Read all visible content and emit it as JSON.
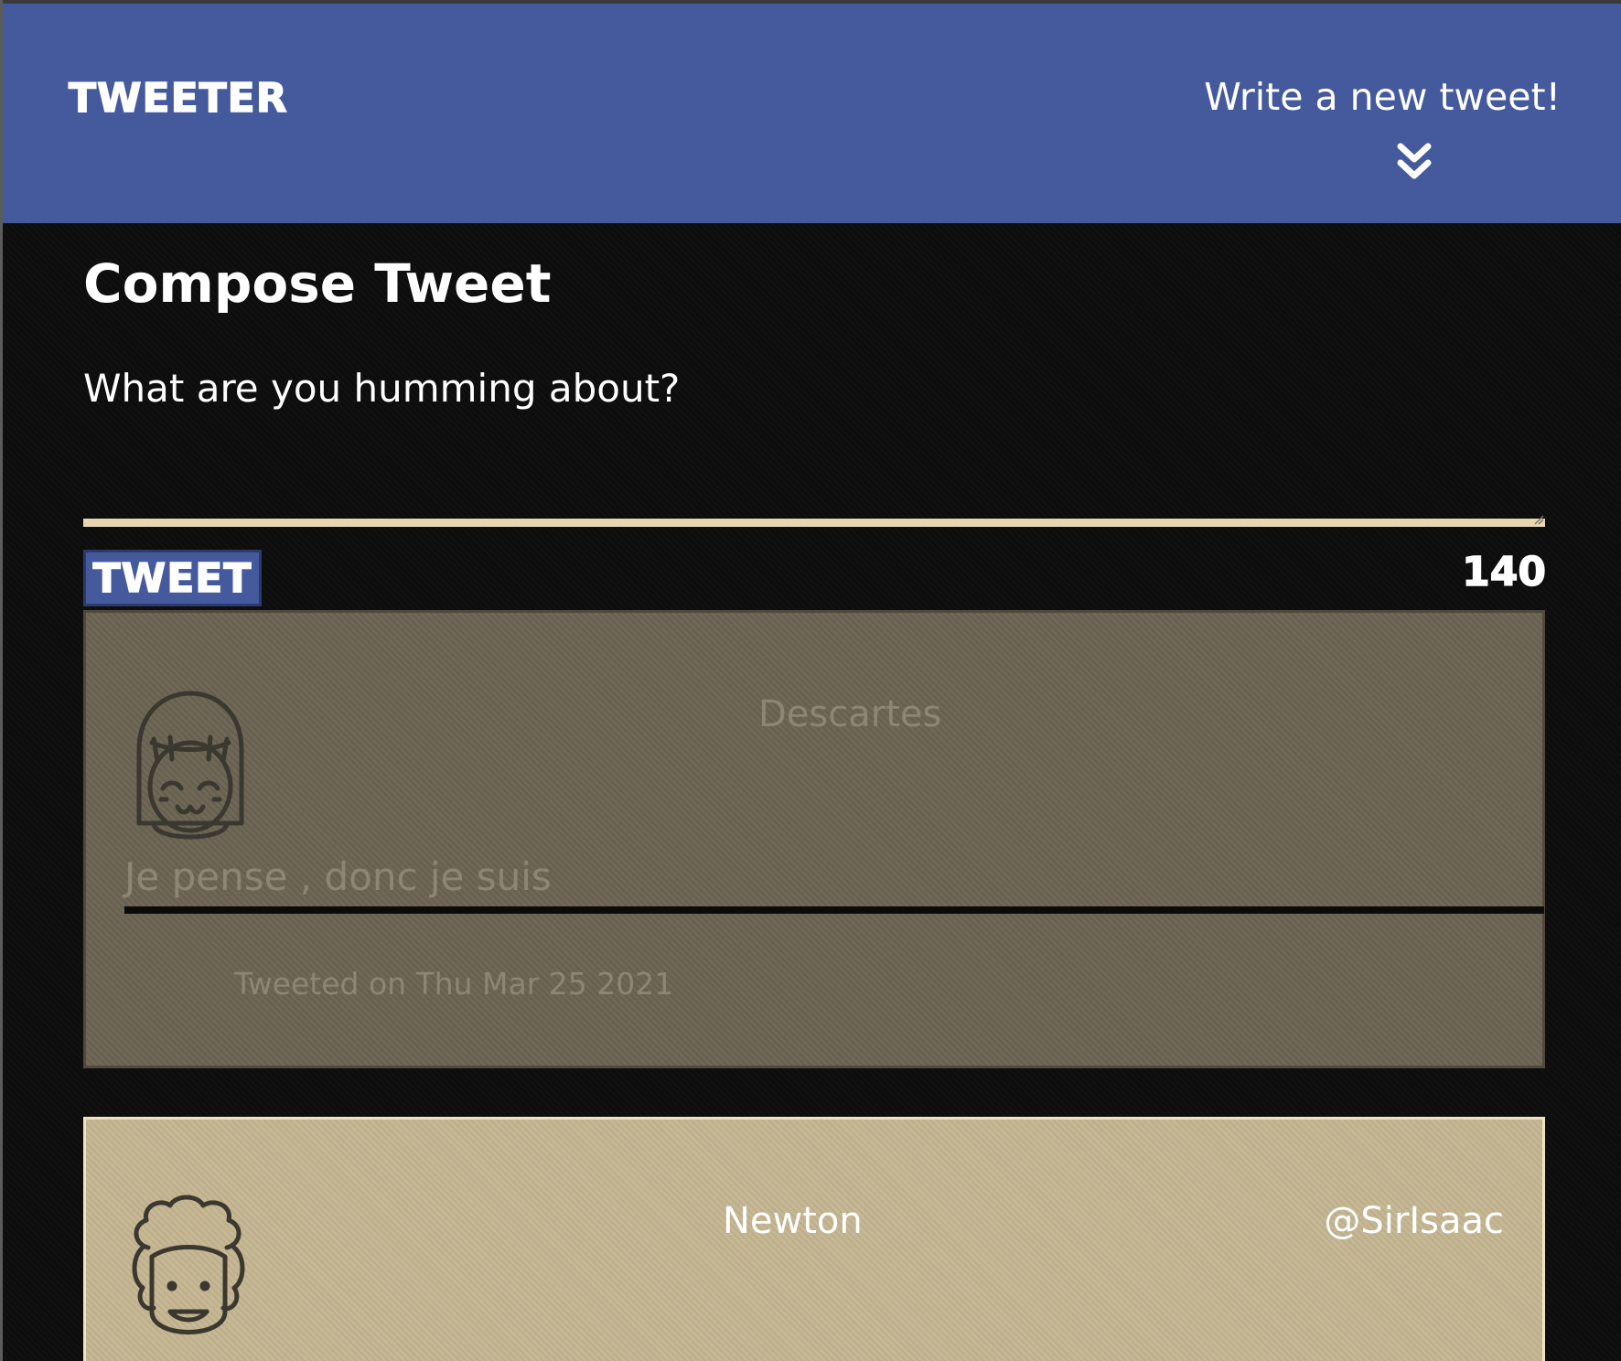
{
  "header": {
    "brand": "TWEETER",
    "write_new_label": "Write a new tweet!",
    "chevron_icon": "double-chevron-down-icon",
    "background_color": "#455a9c"
  },
  "compose": {
    "title": "Compose Tweet",
    "placeholder": "What are you humming about?",
    "submit_label": "TWEET",
    "counter": "140",
    "underline_color": "#e9d6b0"
  },
  "tweets": [
    {
      "name": "Descartes",
      "handle": "",
      "avatar_icon": "girl-avatar-icon",
      "content": "Je pense , donc je suis",
      "date": "Tweeted on Thu Mar 25 2021",
      "background_color": "#6b6352"
    },
    {
      "name": "Newton",
      "handle": "@SirIsaac",
      "avatar_icon": "curly-hair-avatar-icon",
      "background_color": "#c4b591"
    }
  ]
}
